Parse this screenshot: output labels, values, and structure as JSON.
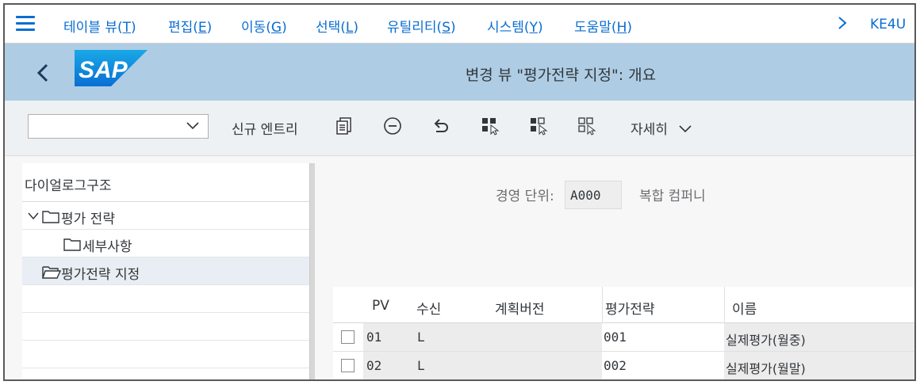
{
  "menu": {
    "items": [
      {
        "label": "테이블 뷰(",
        "key": "T",
        "tail": ")"
      },
      {
        "label": "편집(",
        "key": "E",
        "tail": ")"
      },
      {
        "label": "이동(",
        "key": "G",
        "tail": ")"
      },
      {
        "label": "선택(",
        "key": "L",
        "tail": ")"
      },
      {
        "label": "유틸리티(",
        "key": "S",
        "tail": ")"
      },
      {
        "label": "시스템(",
        "key": "Y",
        "tail": ")"
      },
      {
        "label": "도움말(",
        "key": "H",
        "tail": ")"
      }
    ],
    "system_id": "KE4U"
  },
  "title": {
    "logo_text": "SAP",
    "text": "변경 뷰 \"평가전략 지정\": 개요"
  },
  "toolbar": {
    "combo_value": "",
    "new_entry": "신규 엔트리",
    "details": "자세히",
    "icons": [
      "copy-icon",
      "delete-icon",
      "undo-icon",
      "select-all-icon",
      "select-block-icon",
      "deselect-all-icon"
    ]
  },
  "tree": {
    "header": "다이얼로그구조",
    "items": [
      {
        "label": "평가 전략",
        "level": 0,
        "expanded": true
      },
      {
        "label": "세부사항",
        "level": 1
      },
      {
        "label": "평가전략 지정",
        "level": 0,
        "selected": true
      }
    ]
  },
  "header_fields": {
    "label": "경영 단위:",
    "value": "A000",
    "description": "복합 컴퍼니"
  },
  "table": {
    "columns": [
      "PV",
      "수신",
      "계획버전",
      "평가전략",
      "이름"
    ],
    "rows": [
      {
        "pv": "01",
        "recv": "L",
        "plan": "",
        "strategy": "001",
        "name": "실제평가(월중)"
      },
      {
        "pv": "02",
        "recv": "L",
        "plan": "",
        "strategy": "002",
        "name": "실제평가(월말)"
      }
    ]
  },
  "colors": {
    "accent": "#0a6ed1",
    "title_bar": "#aecde4",
    "toolbar": "#eef1f3"
  }
}
